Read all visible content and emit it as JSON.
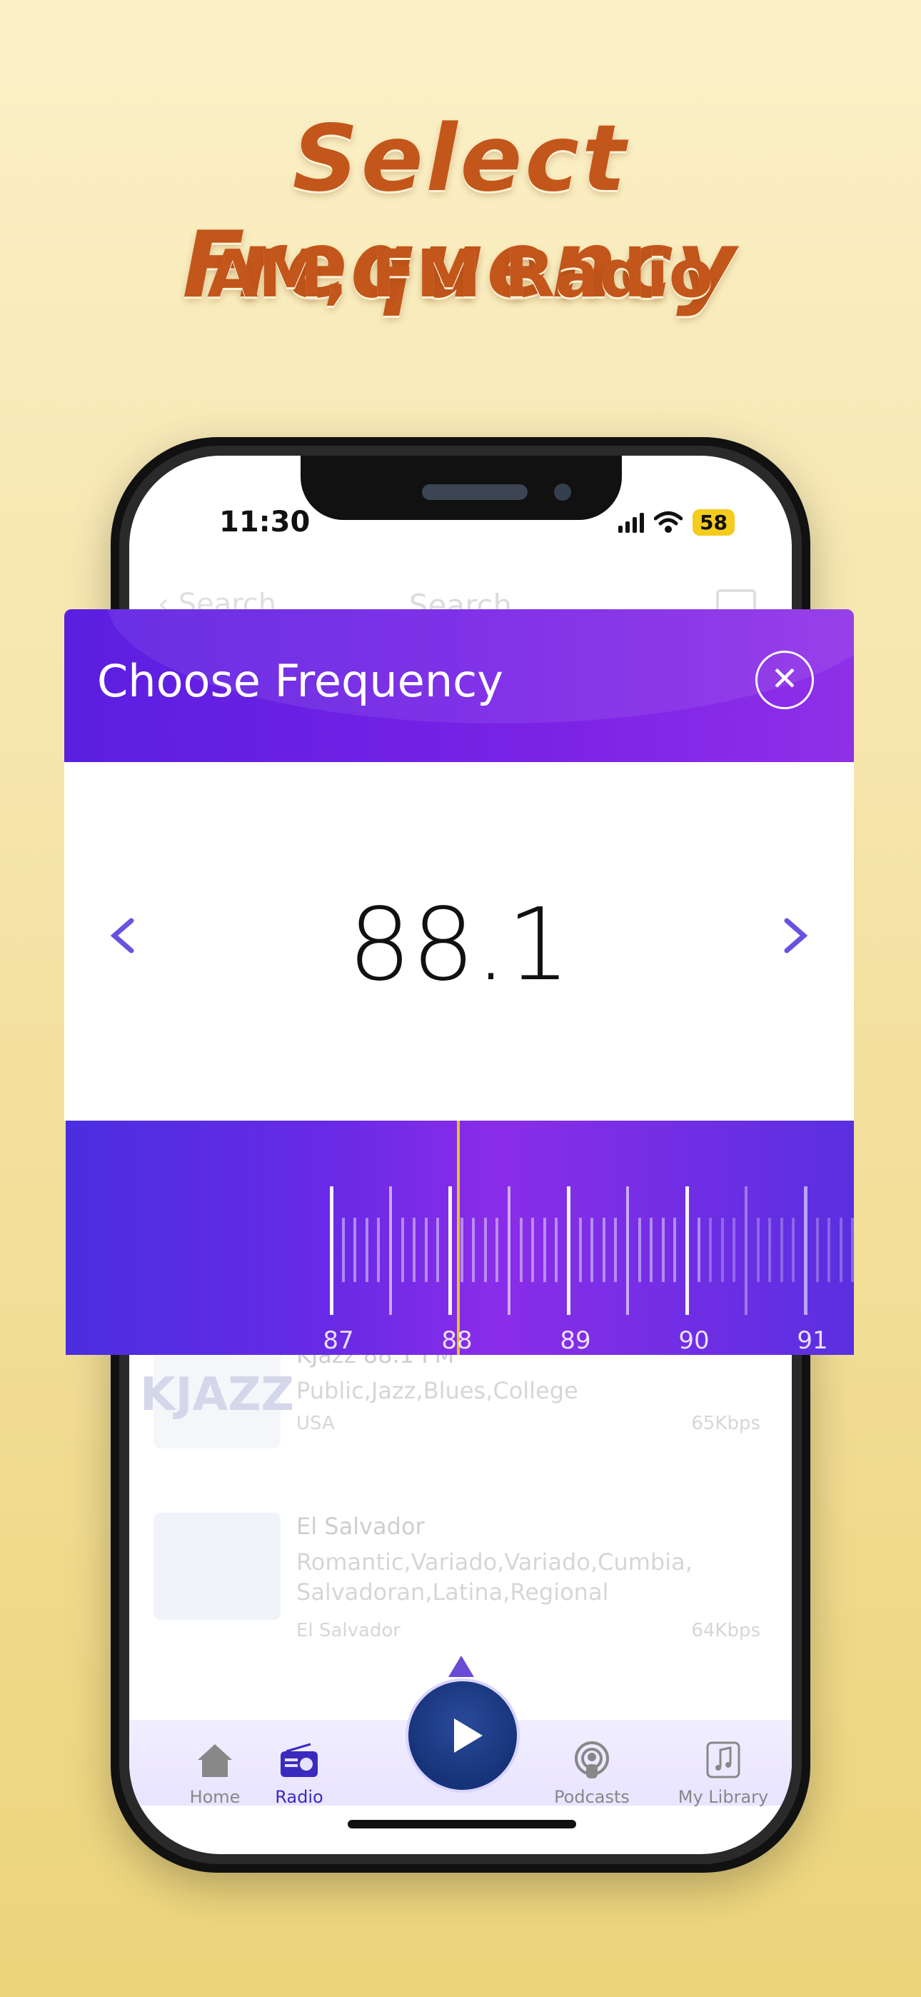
{
  "headline": {
    "title": "Select Frequency",
    "subtitle": "AM, FM Radio"
  },
  "status_bar": {
    "time": "11:30",
    "battery": "58"
  },
  "navbar": {
    "back_label": "Search",
    "title": "Search"
  },
  "dialog": {
    "title": "Choose Frequency",
    "close_icon": "close-circle-icon",
    "frequency": "88.1",
    "prev_icon": "chevron-left-icon",
    "next_icon": "chevron-right-icon",
    "dial_labels": [
      "87",
      "88",
      "89",
      "90",
      "91"
    ],
    "needle_color": "#e8c02a"
  },
  "stations": [
    {
      "title": "KJazz 88.1 FM",
      "genre": "Public,Jazz,Blues,College",
      "country": "USA",
      "bitrate": "65Kbps",
      "logo_text": "KJAZZ"
    },
    {
      "title": "El Salvador",
      "genre": "Romantic,Variado,Variado,Cumbia, Salvadoran,Latina,Regional",
      "country": "El Salvador",
      "bitrate": "64Kbps",
      "logo_text": ""
    }
  ],
  "tabbar": {
    "items": [
      {
        "label": "Home",
        "icon": "home-icon"
      },
      {
        "label": "Radio",
        "icon": "radio-icon"
      },
      {
        "label": "Podcasts",
        "icon": "podcast-icon"
      },
      {
        "label": "My Library",
        "icon": "library-icon"
      }
    ],
    "active": "Radio",
    "player_icon": "play-icon"
  },
  "colors": {
    "accent": "#6a2ae6",
    "headline": "#c3561b",
    "tab_active": "#3a2bbf"
  }
}
